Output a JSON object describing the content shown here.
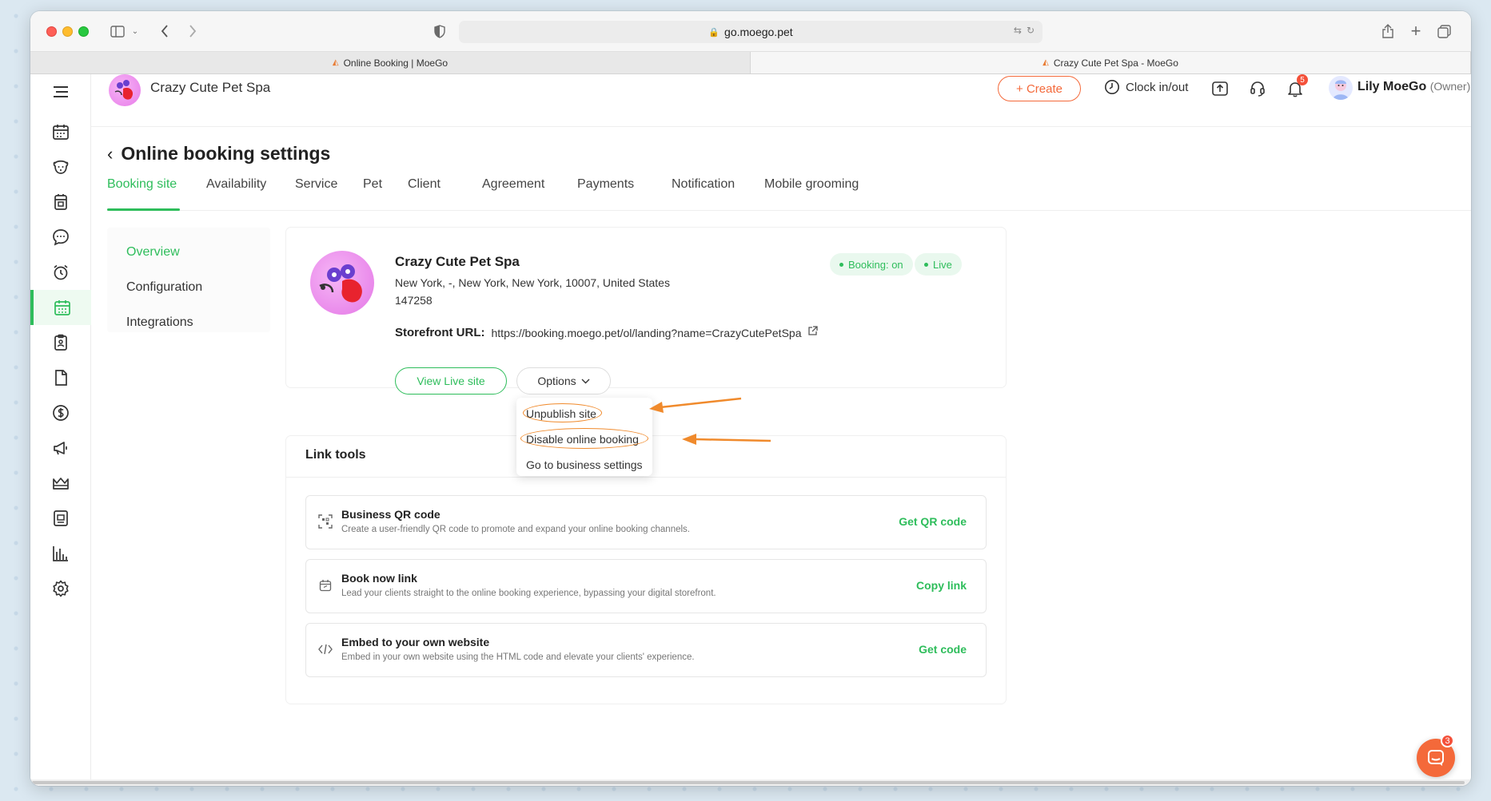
{
  "browser": {
    "url": "go.moego.pet",
    "tabs": [
      {
        "label": "Online Booking | MoeGo",
        "active": false
      },
      {
        "label": "Crazy Cute Pet Spa - MoeGo",
        "active": true
      }
    ]
  },
  "topbar": {
    "business_name": "Crazy Cute Pet Spa",
    "create_label": "+ Create",
    "clock_label": "Clock in/out",
    "notification_count": "5",
    "user_name": "Lily MoeGo",
    "user_role": "(Owner)"
  },
  "page": {
    "title": "Online booking settings",
    "tabs": [
      "Booking site",
      "Availability",
      "Service",
      "Pet",
      "Client",
      "Agreement",
      "Payments",
      "Notification",
      "Mobile grooming"
    ],
    "active_tab": "Booking site"
  },
  "left_menu": {
    "items": [
      "Overview",
      "Configuration",
      "Integrations"
    ],
    "active": "Overview"
  },
  "site_card": {
    "name": "Crazy Cute Pet Spa",
    "address": "New York, -, New York, New York, 10007, United States",
    "zip": "147258",
    "storefront_label": "Storefront URL:",
    "storefront_url": "https://booking.moego.pet/ol/landing?name=CrazyCutePetSpa",
    "status_booking": "Booking: on",
    "status_live": "Live",
    "view_live_label": "View Live site",
    "options_label": "Options"
  },
  "options_menu": {
    "items": [
      "Unpublish site",
      "Disable online booking",
      "Go to business settings"
    ]
  },
  "link_tools": {
    "title": "Link tools",
    "rows": [
      {
        "name": "Business QR code",
        "desc": "Create a user-friendly QR code to promote and expand your online booking channels.",
        "action": "Get QR code",
        "icon": "qr-icon"
      },
      {
        "name": "Book now link",
        "desc": "Lead your clients straight to the online booking experience, bypassing your digital storefront.",
        "action": "Copy link",
        "icon": "calendar-link-icon"
      },
      {
        "name": "Embed to your own website",
        "desc": "Embed in your own website using the HTML code and elevate your clients' experience.",
        "action": "Get code",
        "icon": "code-icon"
      }
    ]
  },
  "chat": {
    "badge": "3"
  },
  "colors": {
    "accent": "#2ebd5b",
    "brand": "#f4693a",
    "annotation": "#f08a2c"
  }
}
